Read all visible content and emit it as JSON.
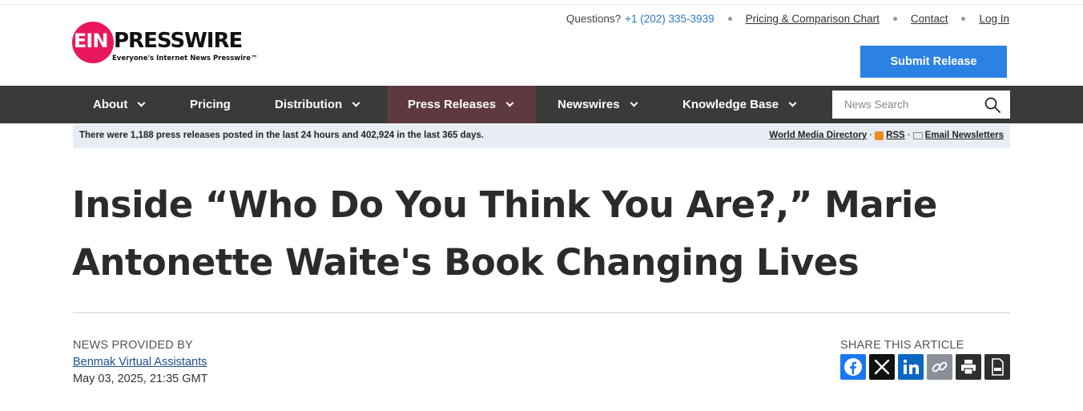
{
  "brand": {
    "ein": "EIN",
    "presswire": "PRESSWIRE",
    "tagline": "Everyone's Internet News Presswire™",
    "pink": "#e8175d"
  },
  "toplinks": {
    "questions": "Questions?",
    "phone": "+1 (202) 335-3939",
    "pricing_chart": "Pricing & Comparison Chart",
    "contact": "Contact",
    "login": "Log In"
  },
  "submit_label": "Submit Release",
  "nav": {
    "about": "About",
    "pricing": "Pricing",
    "distribution": "Distribution",
    "press_releases": "Press Releases",
    "newswires": "Newswires",
    "knowledge_base": "Knowledge Base"
  },
  "search": {
    "placeholder": "News Search"
  },
  "info": {
    "stats": "There were 1,188 press releases posted in the last 24 hours and 402,924 in the last 365 days.",
    "world_media": "World Media Directory",
    "rss": "RSS",
    "email": "Email Newsletters",
    "sep": "·"
  },
  "article": {
    "title": "Inside “Who Do You Think You Are?,” Marie Antonette Waite's Book Changing Lives",
    "provided_by_label": "NEWS PROVIDED BY",
    "provider": "Benmak Virtual Assistants",
    "date": "May 03, 2025, 21:35 GMT"
  },
  "share": {
    "label": "SHARE THIS ARTICLE",
    "buttons": [
      "facebook-icon",
      "x-icon",
      "linkedin-icon",
      "link-icon",
      "print-icon",
      "pdf-icon"
    ]
  },
  "colors": {
    "accent_blue": "#2b82e3",
    "nav_bg": "#3a3a3a",
    "nav_active": "#5e3a40",
    "facebook": "#1877f2",
    "linkedin": "#0a66c2"
  }
}
